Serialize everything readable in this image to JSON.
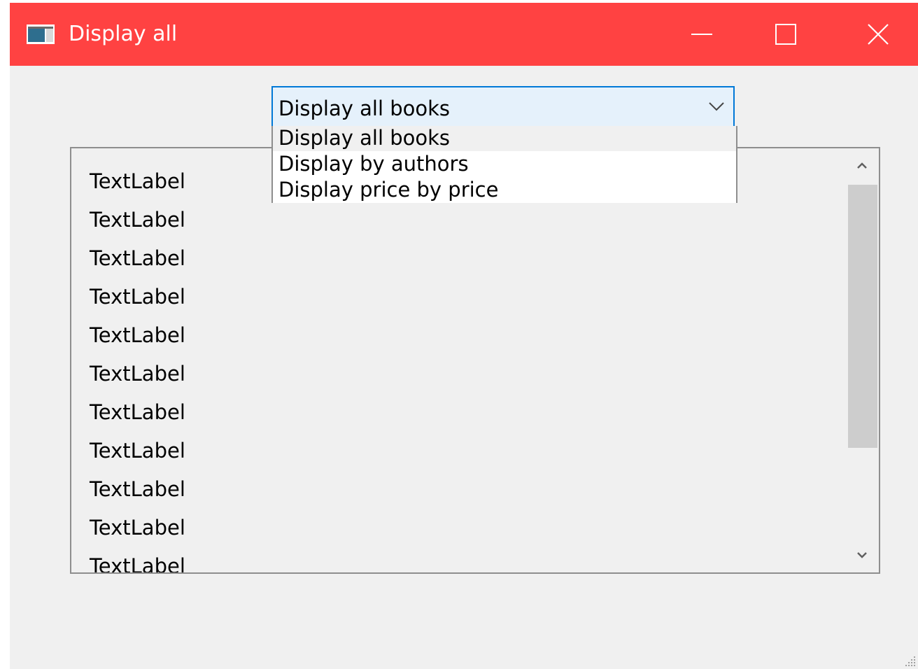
{
  "window": {
    "title": "Display all",
    "accent": "#ff4242",
    "controls": [
      "minimize-icon",
      "maximize-icon",
      "close-icon"
    ]
  },
  "combo": {
    "value": "Display all books",
    "options": [
      "Display all books",
      "Display by authors",
      "Display price by price"
    ],
    "selected_index": 0
  },
  "labels": [
    "TextLabel",
    "TextLabel",
    "TextLabel",
    "TextLabel",
    "TextLabel",
    "TextLabel",
    "TextLabel",
    "TextLabel",
    "TextLabel",
    "TextLabel",
    "TextLabel"
  ],
  "scrollbar": {
    "position_fraction": 0
  }
}
